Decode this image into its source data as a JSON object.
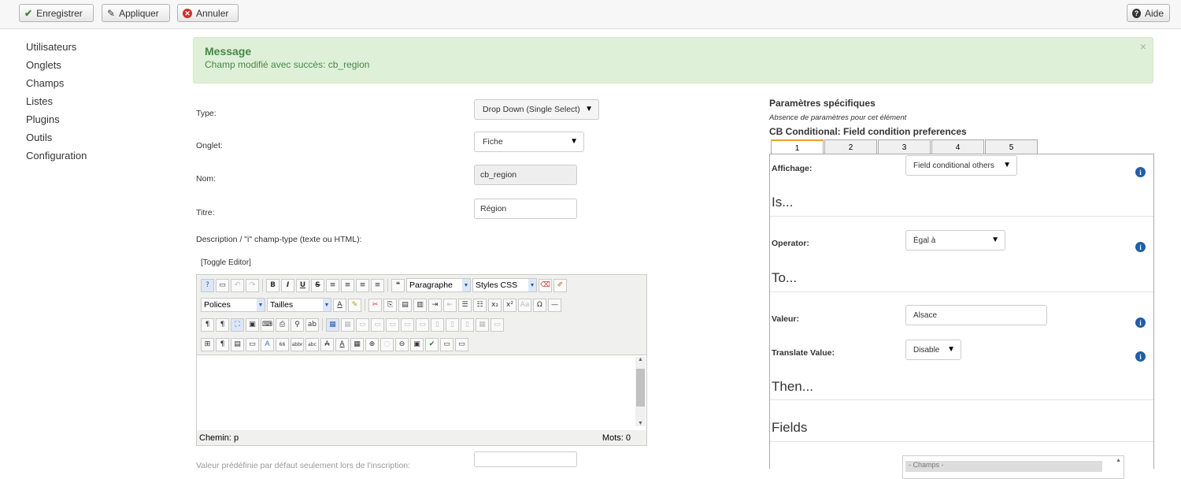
{
  "toolbar": {
    "save_label": "Enregistrer",
    "apply_label": "Appliquer",
    "cancel_label": "Annuler",
    "help_label": "Aide"
  },
  "sidebar": {
    "items": [
      {
        "label": "Utilisateurs"
      },
      {
        "label": "Onglets"
      },
      {
        "label": "Champs"
      },
      {
        "label": "Listes"
      },
      {
        "label": "Plugins"
      },
      {
        "label": "Outils"
      },
      {
        "label": "Configuration"
      }
    ]
  },
  "alert": {
    "heading": "Message",
    "text": "Champ modifié avec succès: cb_region",
    "close": "×"
  },
  "form": {
    "type_label": "Type:",
    "type_value": "Drop Down (Single Select)",
    "tab_label": "Onglet:",
    "tab_value": "Fiche",
    "name_label": "Nom:",
    "name_value": "cb_region",
    "title_label": "Titre:",
    "title_value": "Région",
    "description_label": "Description / \"i\" champ-type (texte ou HTML):",
    "toggle_editor": "[Toggle Editor]",
    "default_label": "Valeur prédéfinie par défaut seulement lors de l'inscription:"
  },
  "editor": {
    "format_dropdown": "Paragraphe",
    "styles_dropdown": "Styles CSS",
    "fonts_dropdown": "Polices",
    "sizes_dropdown": "Tailles",
    "path_label": "Chemin: p",
    "words_label": "Mots: 0"
  },
  "right_panel": {
    "title": "Paramètres spécifiques",
    "subtitle": "Absence de paramètres pour cet élément",
    "conditional_title": "CB Conditional: Field condition preferences",
    "tabs": [
      "1",
      "2",
      "3",
      "4",
      "5"
    ],
    "display_label": "Affichage:",
    "display_value": "Field conditional others",
    "section_is": "Is...",
    "operator_label": "Operator:",
    "operator_value": "Égal à",
    "section_to": "To...",
    "value_label": "Valeur:",
    "value_value": "Alsace",
    "translate_label": "Translate Value:",
    "translate_value": "Disable",
    "section_then": "Then...",
    "section_fields": "Fields",
    "fields_option": "- Champs -"
  }
}
